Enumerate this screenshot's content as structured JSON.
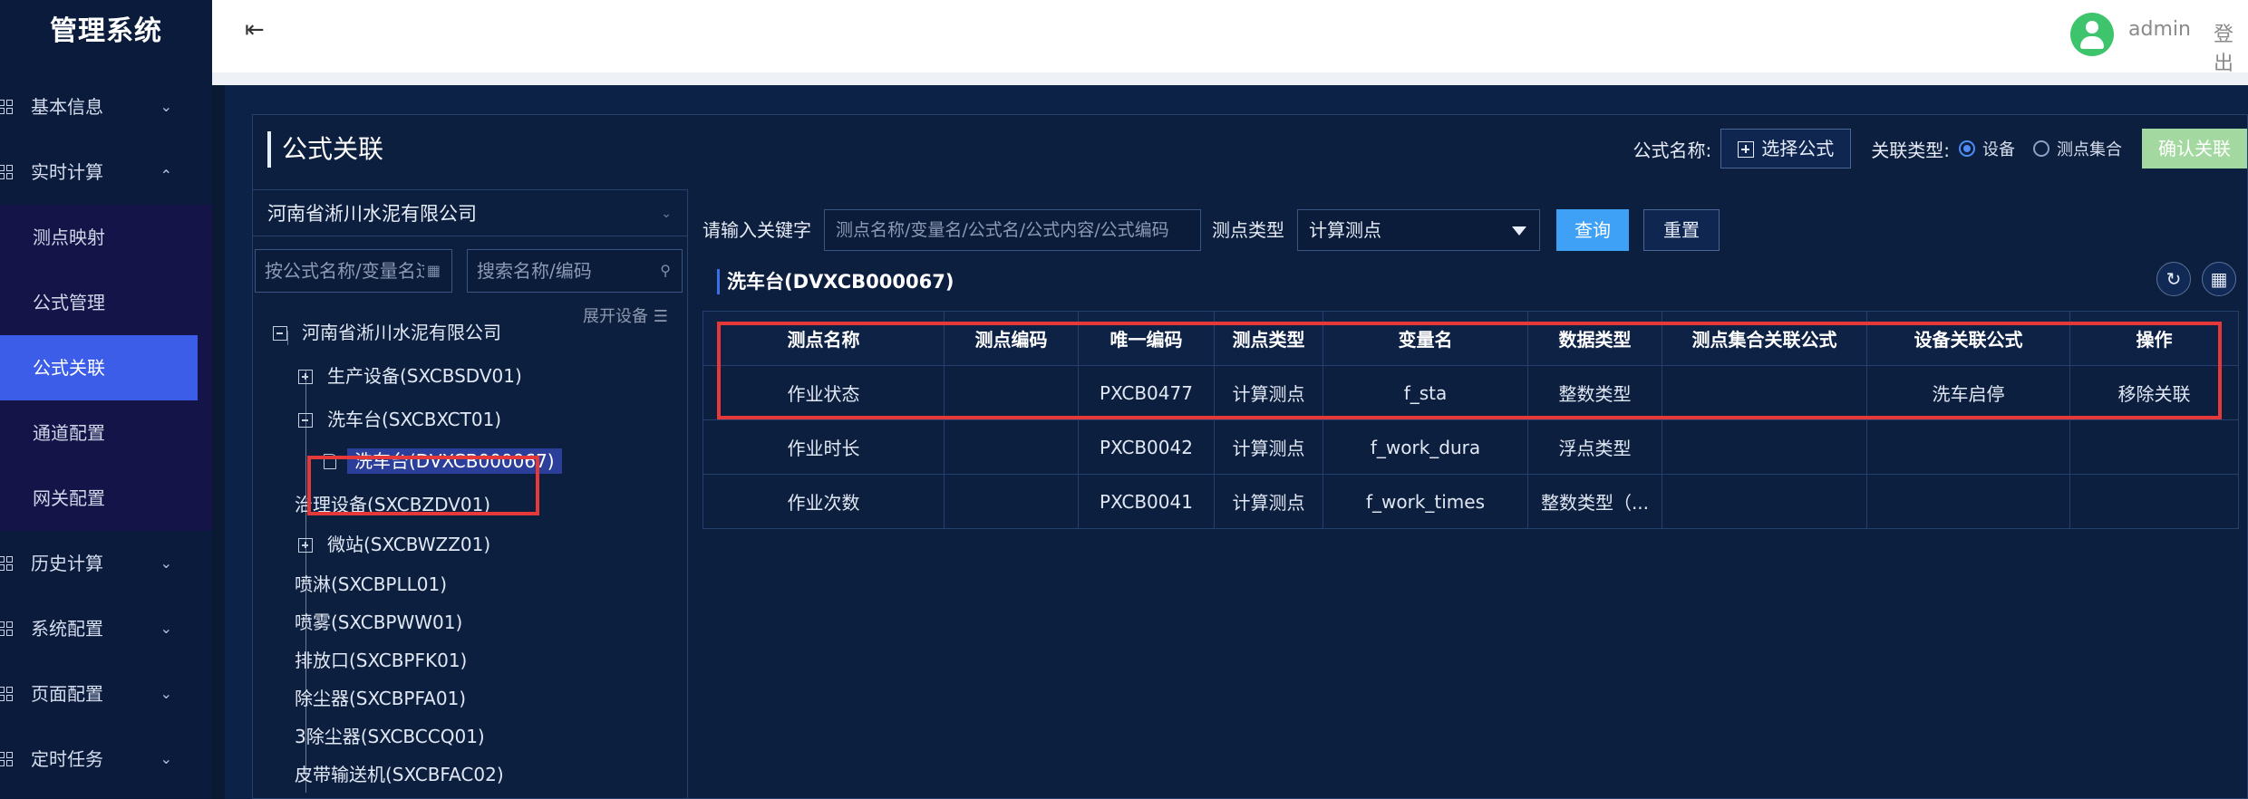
{
  "app": {
    "title": "管理系统"
  },
  "sidebar": {
    "items": [
      {
        "label": "基本信息",
        "expanded": false
      },
      {
        "label": "实时计算",
        "expanded": true
      },
      {
        "label": "历史计算",
        "expanded": false
      },
      {
        "label": "系统配置",
        "expanded": false
      },
      {
        "label": "页面配置",
        "expanded": false
      },
      {
        "label": "定时任务",
        "expanded": false
      }
    ],
    "subitems": [
      "测点映射",
      "公式管理",
      "公式关联",
      "通道配置",
      "网关配置"
    ],
    "active_subitem": "公式关联"
  },
  "header": {
    "username": "admin",
    "logout": "登出"
  },
  "panel": {
    "title": "公式关联",
    "formula_name_label": "公式名称:",
    "select_formula_button": "选择公式",
    "relation_type_label": "关联类型:",
    "radio_device": "设备",
    "radio_point_set": "测点集合",
    "selected_relation_type": "设备",
    "confirm_button": "确认关联"
  },
  "tree": {
    "company": "河南省淅川水泥有限公司",
    "search_formula_placeholder": "按公式名称/变量名过滤",
    "search_name_placeholder": "搜索名称/编码",
    "expand_device_label": "展开设备",
    "nodes": {
      "root": "河南省淅川水泥有限公司",
      "production": "生产设备(SXCBSDV01)",
      "wash_group": "洗车台(SXCBXCT01)",
      "wash_selected": "洗车台(DVXCB000067)",
      "governance": "治理设备(SXCBZDV01)",
      "micro_station": "微站(SXCBWZZ01)",
      "spray_l": "喷淋(SXCBPLL01)",
      "spray_w": "喷雾(SXCBPWW01)",
      "outlet": "排放口(SXCBPFK01)",
      "dust": "除尘器(SXCBPFA01)",
      "dust3": "3除尘器(SXCBCCQ01)",
      "conveyor": "皮带输送机(SXCBFAC02)"
    }
  },
  "filter": {
    "keyword_label": "请输入关键字",
    "keyword_placeholder": "测点名称/变量名/公式名/公式内容/公式编码",
    "type_label": "测点类型",
    "type_value": "计算测点",
    "query_button": "查询",
    "reset_button": "重置"
  },
  "device_title": "洗车台(DVXCB000067)",
  "table": {
    "columns": [
      "测点名称",
      "测点编码",
      "唯一编码",
      "测点类型",
      "变量名",
      "数据类型",
      "测点集合关联公式",
      "设备关联公式",
      "操作"
    ],
    "rows": [
      {
        "name": "作业状态",
        "code": "",
        "uid": "PXCB0477",
        "type": "计算测点",
        "var": "f_sta",
        "dtype": "整数类型",
        "set_formula": "",
        "device_formula": "洗车启停",
        "action": "移除关联"
      },
      {
        "name": "作业时长",
        "code": "",
        "uid": "PXCB0042",
        "type": "计算测点",
        "var": "f_work_dura",
        "dtype": "浮点类型",
        "set_formula": "",
        "device_formula": "",
        "action": ""
      },
      {
        "name": "作业次数",
        "code": "",
        "uid": "PXCB0041",
        "type": "计算测点",
        "var": "f_work_times",
        "dtype": "整数类型（...",
        "set_formula": "",
        "device_formula": "",
        "action": ""
      }
    ]
  },
  "colors": {
    "accent": "#3b5de7",
    "highlight_border": "#e53939",
    "link": "#4a8ef7",
    "confirm": "#a3d9a0"
  }
}
